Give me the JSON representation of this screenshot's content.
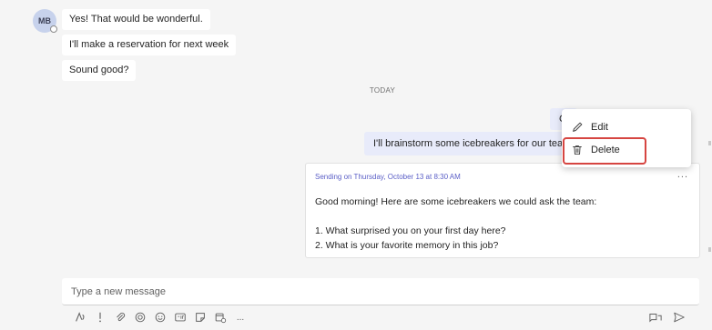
{
  "chat": {
    "avatar_initials": "MB",
    "incoming": [
      "Yes! That would be wonderful.",
      "I'll make a reservation for next week",
      "Sound good?"
    ],
    "day_divider": "TODAY",
    "outgoing_1_peek": "C",
    "outgoing_2": "I'll brainstorm some icebreakers for our team"
  },
  "scheduled": {
    "sending_label": "Sending on Thursday, October 13 at 8:30 AM",
    "more": "...",
    "lines": [
      "Good morning! Here are some icebreakers we could ask the team:",
      "1. What surprised you on your first day here?",
      "2. What is your favorite memory in this job?"
    ]
  },
  "context_menu": {
    "edit_label": "Edit",
    "delete_label": "Delete"
  },
  "composer": {
    "placeholder": "Type a new message",
    "more": "..."
  },
  "colors": {
    "accent": "#5b5fc7",
    "highlight": "#d64541",
    "outgoing_bubble": "#e8ebfa"
  }
}
